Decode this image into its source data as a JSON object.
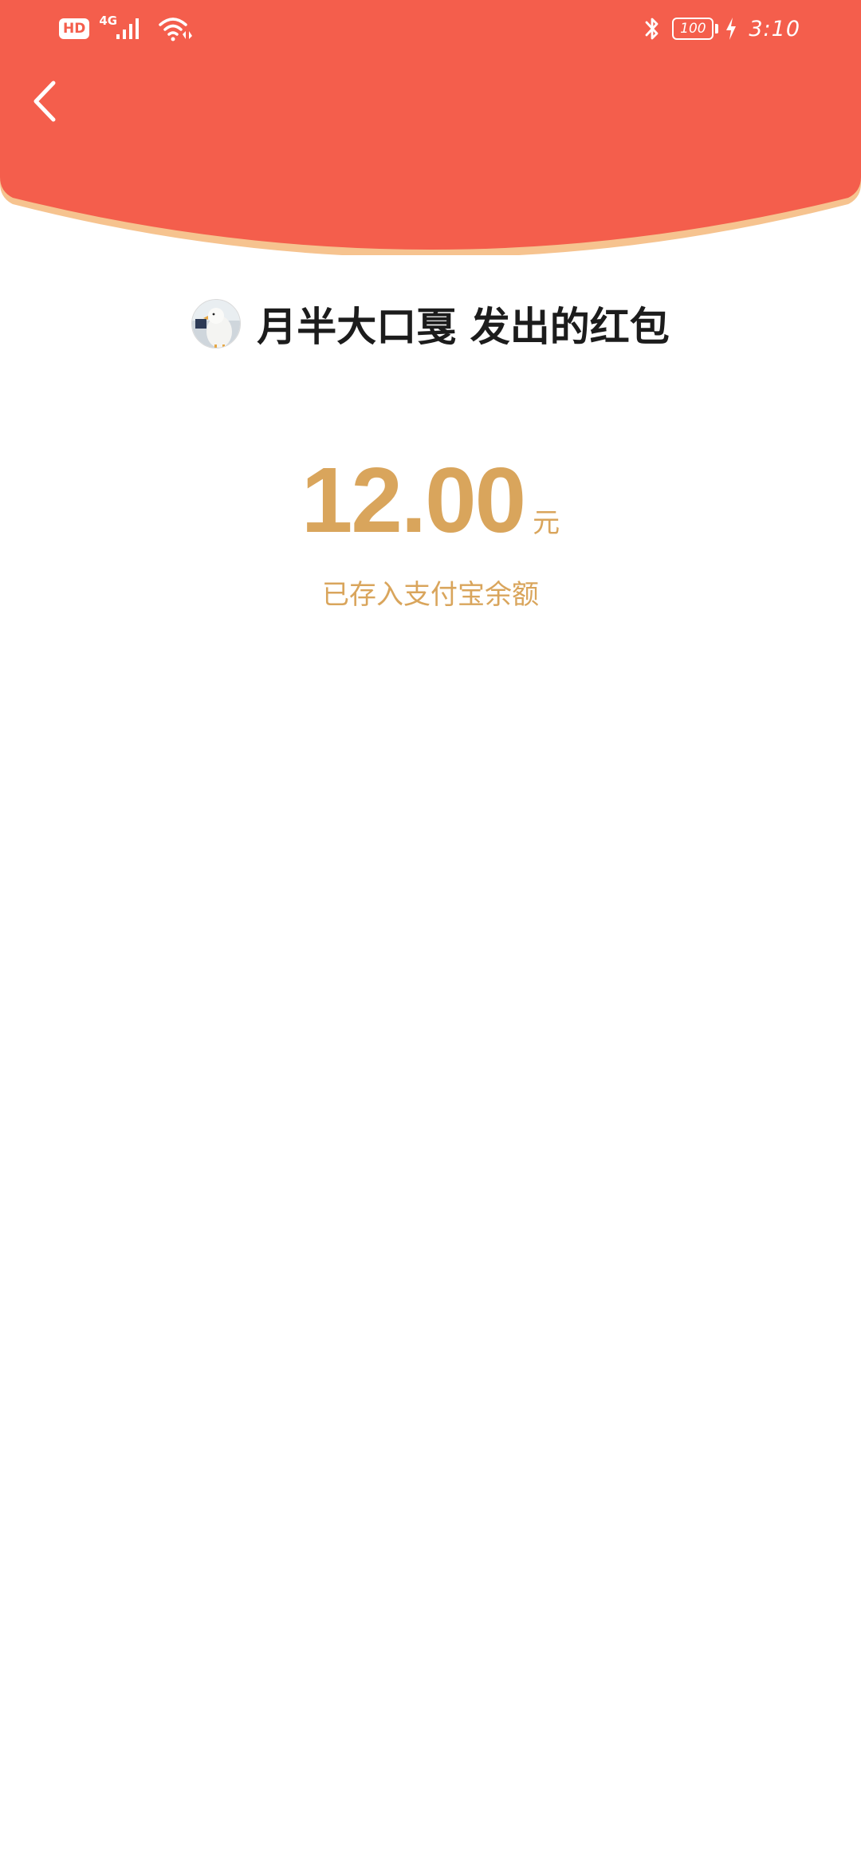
{
  "colors": {
    "header_red": "#f45e4c",
    "header_edge": "#f6c38f",
    "gold": "#d9a55c",
    "title_text": "#1c1c1c",
    "background": "#ffffff"
  },
  "status_bar": {
    "hd_label": "HD",
    "network_label": "4G",
    "battery_level": "100",
    "time": "3:10",
    "icons": [
      "hd-icon",
      "signal-icon",
      "wifi-icon",
      "bluetooth-icon",
      "battery-icon",
      "charging-icon"
    ]
  },
  "header": {
    "back_icon": "chevron-left-icon"
  },
  "sender": {
    "avatar_icon": "avatar",
    "title": "月半大口戛 发出的红包"
  },
  "amount": {
    "value": "12.00",
    "unit": "元",
    "note": "已存入支付宝余额"
  }
}
